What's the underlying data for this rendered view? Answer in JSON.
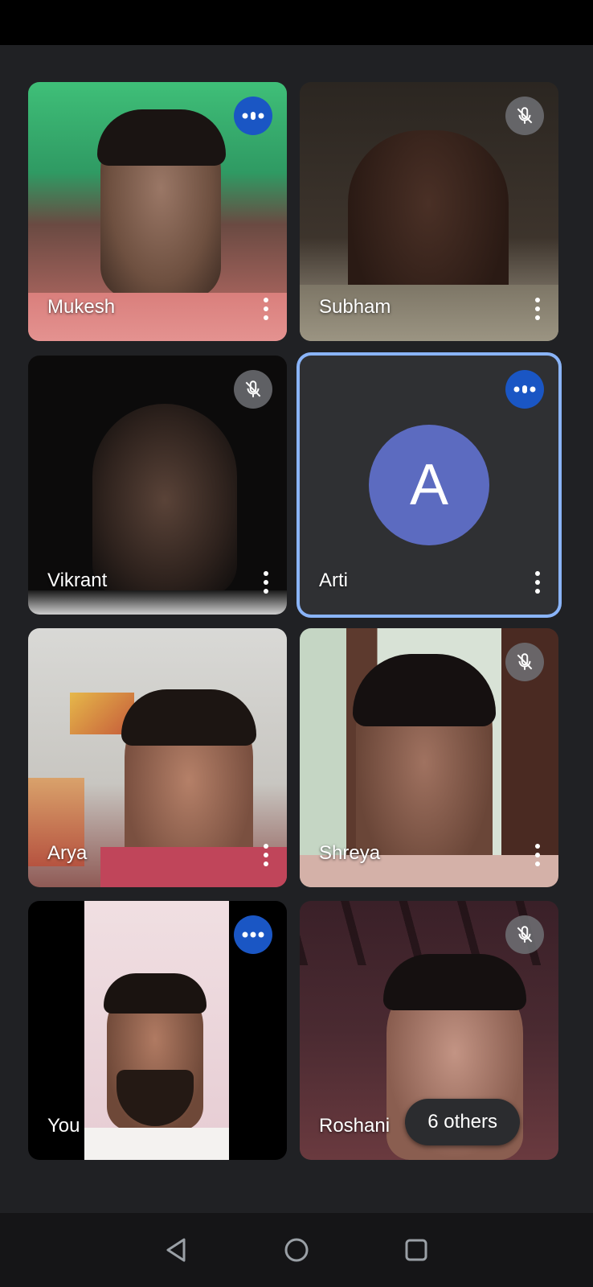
{
  "participants": [
    {
      "name": "Mukesh",
      "mic": "speaking",
      "avatar": ""
    },
    {
      "name": "Subham",
      "mic": "muted",
      "avatar": ""
    },
    {
      "name": "Vikrant",
      "mic": "muted",
      "avatar": ""
    },
    {
      "name": "Arti",
      "mic": "speaking",
      "avatar": "A"
    },
    {
      "name": "Arya",
      "mic": "none",
      "avatar": ""
    },
    {
      "name": "Shreya",
      "mic": "muted",
      "avatar": ""
    },
    {
      "name": "You",
      "mic": "speaking",
      "avatar": ""
    },
    {
      "name": "Roshani",
      "mic": "muted",
      "avatar": ""
    }
  ],
  "others_label": "6 others",
  "colors": {
    "background": "#202124",
    "speaking_badge": "#1a56c4",
    "active_border": "#8ab4f8",
    "avatar_bg": "#5c6bc0"
  },
  "nav": {
    "back_icon": "back-triangle-icon",
    "home_icon": "home-circle-icon",
    "recents_icon": "recents-square-icon"
  }
}
